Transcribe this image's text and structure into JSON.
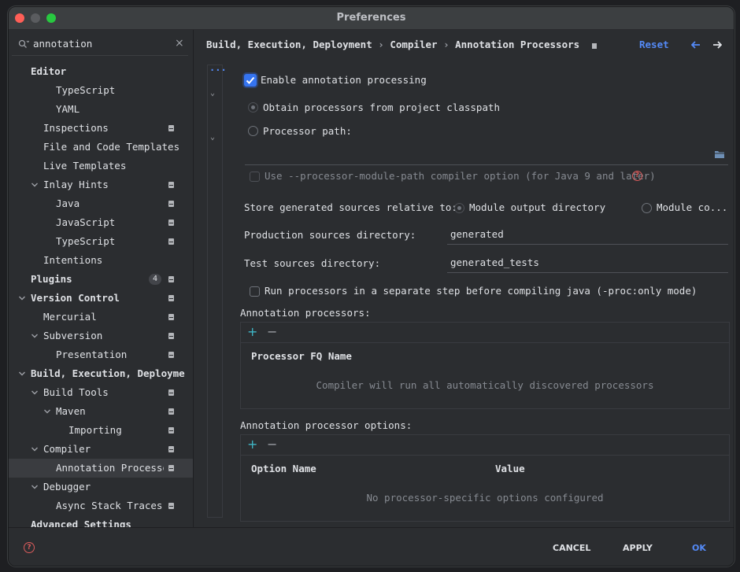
{
  "window": {
    "title": "Preferences"
  },
  "colors": {
    "accent": "#3574f0",
    "link": "#548af7",
    "text": "#dfe1e5",
    "muted": "#868a91",
    "error": "#db5c5c"
  },
  "search": {
    "value": "annotation"
  },
  "sidebar": {
    "items": [
      {
        "label": "Editor",
        "bold": true
      },
      {
        "label": "TypeScript"
      },
      {
        "label": "YAML"
      },
      {
        "label": "Inspections"
      },
      {
        "label": "File and Code Templates"
      },
      {
        "label": "Live Templates"
      },
      {
        "label": "Inlay Hints"
      },
      {
        "label": "Java"
      },
      {
        "label": "JavaScript"
      },
      {
        "label": "TypeScript"
      },
      {
        "label": "Intentions"
      },
      {
        "label": "Plugins",
        "bold": true,
        "count": "4"
      },
      {
        "label": "Version Control",
        "bold": true
      },
      {
        "label": "Mercurial"
      },
      {
        "label": "Subversion"
      },
      {
        "label": "Presentation"
      },
      {
        "label": "Build, Execution, Deployme",
        "bold": true
      },
      {
        "label": "Build Tools"
      },
      {
        "label": "Maven"
      },
      {
        "label": "Importing"
      },
      {
        "label": "Compiler"
      },
      {
        "label": "Annotation Processors"
      },
      {
        "label": "Debugger"
      },
      {
        "label": "Async Stack Traces"
      },
      {
        "label": "Advanced Settings",
        "bold": true
      }
    ]
  },
  "header": {
    "breadcrumb": [
      "Build, Execution, Deployment",
      "Compiler",
      "Annotation Processors"
    ],
    "reset": "Reset"
  },
  "form": {
    "enable_label": "Enable annotation processing",
    "enable_checked": true,
    "obtain_label": "Obtain processors from project classpath",
    "processor_path_label": "Processor path:",
    "module_path_label": "Use --processor-module-path compiler option (for Java 9 and later)",
    "store_label": "Store generated sources relative to:",
    "module_output_label": "Module output directory",
    "module_content_label": "Module co...",
    "production_label": "Production sources directory:",
    "production_value": "generated",
    "test_label": "Test sources directory:",
    "test_value": "generated_tests",
    "run_separate_label": "Run processors in a separate step before compiling java (-proc:only mode)"
  },
  "processors": {
    "section_label": "Annotation processors:",
    "column": "Processor FQ Name",
    "empty": "Compiler will run all automatically discovered processors"
  },
  "options": {
    "section_label": "Annotation processor options:",
    "columns": [
      "Option Name",
      "Value"
    ],
    "empty": "No processor-specific options configured"
  },
  "footer": {
    "cancel": "CANCEL",
    "apply": "APPLY",
    "ok": "OK"
  }
}
